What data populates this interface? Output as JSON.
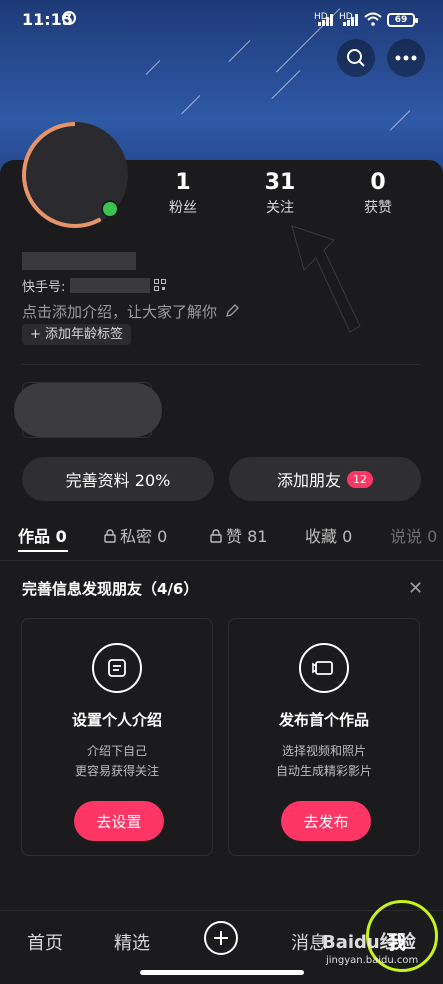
{
  "status_bar": {
    "time": "11:15",
    "network_1": "HD",
    "network_2": "HD",
    "battery": "69"
  },
  "stats": [
    {
      "value": "1",
      "label": "粉丝"
    },
    {
      "value": "31",
      "label": "关注"
    },
    {
      "value": "0",
      "label": "获赞"
    }
  ],
  "profile": {
    "id_label": "快手号:",
    "intro_placeholder": "点击添加介绍，让大家了解你",
    "age_tag": "添加年龄标签"
  },
  "actions": {
    "complete_profile": "完善资料 20%",
    "add_friend": "添加朋友",
    "add_friend_badge": "12"
  },
  "tabs": [
    {
      "label": "作品 0",
      "locked": false
    },
    {
      "label": "私密 0",
      "locked": true
    },
    {
      "label": "赞 81",
      "locked": true
    },
    {
      "label": "收藏 0",
      "locked": false
    },
    {
      "label": "说说 0",
      "locked": false
    }
  ],
  "find_friends": {
    "title": "完善信息发现朋友（4/6）",
    "cards": [
      {
        "icon": "document-icon",
        "title": "设置个人介绍",
        "desc_1": "介绍下自己",
        "desc_2": "更容易获得关注",
        "button": "去设置"
      },
      {
        "icon": "video-camera-icon",
        "title": "发布首个作品",
        "desc_1": "选择视频和照片",
        "desc_2": "自动生成精彩影片",
        "button": "去发布"
      }
    ]
  },
  "bottom_nav": {
    "home": "首页",
    "featured": "精选",
    "messages": "消息",
    "me": "我"
  },
  "watermark": {
    "brand": "Baidu经验",
    "url": "jingyan.baidu.com"
  },
  "colors": {
    "accent": "#fe3666",
    "online": "#3cc24e",
    "highlight_ring": "#c7f21a"
  }
}
